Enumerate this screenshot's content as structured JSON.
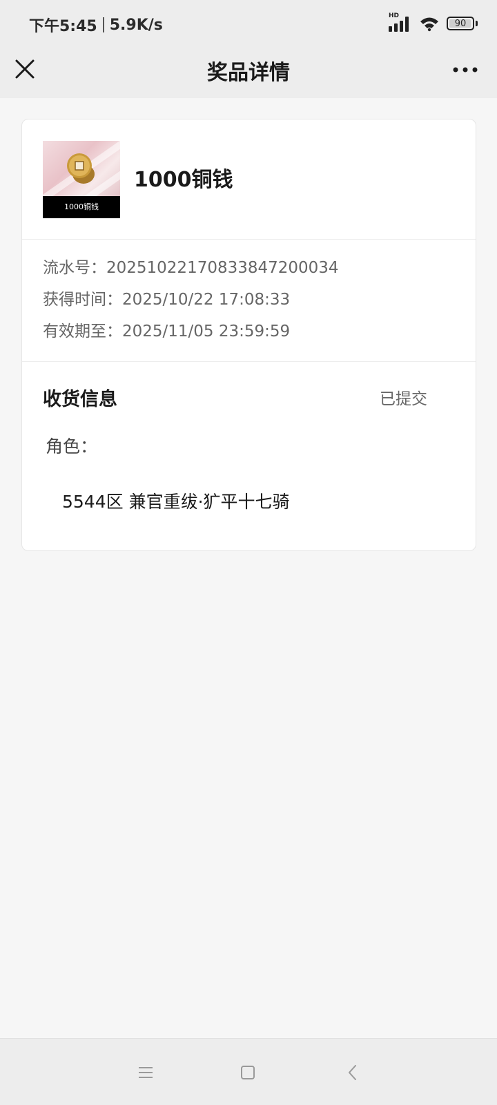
{
  "status_bar": {
    "time": "下午5:45",
    "net_speed": "5.9K/s",
    "signal_label": "HD",
    "battery": "90"
  },
  "nav": {
    "title": "奖品详情",
    "close_icon": "close-icon",
    "more_icon": "more-icon"
  },
  "prize": {
    "thumb_caption": "1000铜钱",
    "name": "1000铜钱"
  },
  "info": {
    "serial": "流水号：20251022170833847200034",
    "obtained": "获得时间：2025/10/22 17:08:33",
    "expires": "有效期至：2025/11/05 23:59:59"
  },
  "shipping": {
    "title": "收货信息",
    "status": "已提交",
    "role_label": "角色：",
    "role_value": "5544区 兼官重绂·犷平十七骑"
  },
  "system_nav": {
    "menu_icon": "menu-icon",
    "home_icon": "home-icon",
    "back_icon": "back-icon"
  },
  "colors": {
    "bar_bg": "#ededed",
    "page_bg": "#f6f6f6",
    "card_bg": "#ffffff",
    "muted_text": "#666666"
  }
}
